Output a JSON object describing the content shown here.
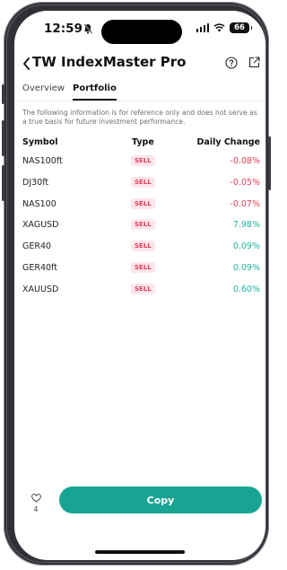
{
  "status_bar": {
    "time": "12:59",
    "battery": "66"
  },
  "header": {
    "title": "TW IndexMaster Pro",
    "icons": [
      "chevron-left-icon",
      "help-icon",
      "share-icon"
    ]
  },
  "tabs": [
    {
      "label": "Overview",
      "active": false
    },
    {
      "label": "Portfolio",
      "active": true
    }
  ],
  "disclaimer": "The following information is for reference only and does not serve as a true basis for future investment performance.",
  "table": {
    "columns": [
      "Symbol",
      "Type",
      "Daily Change"
    ],
    "rows": [
      {
        "symbol": "NAS100ft",
        "type": "SELL",
        "change": "-0.08%"
      },
      {
        "symbol": "DJ30ft",
        "type": "SELL",
        "change": "-0.05%"
      },
      {
        "symbol": "NAS100",
        "type": "SELL",
        "change": "-0.07%"
      },
      {
        "symbol": "XAGUSD",
        "type": "SELL",
        "change": "7.98%"
      },
      {
        "symbol": "GER40",
        "type": "SELL",
        "change": "0.09%"
      },
      {
        "symbol": "GER40ft",
        "type": "SELL",
        "change": "0.09%"
      },
      {
        "symbol": "XAUUSD",
        "type": "SELL",
        "change": "0.60%"
      }
    ]
  },
  "footer": {
    "favorite_count": "4",
    "copy_label": "Copy"
  },
  "colors": {
    "accent": "#17a493",
    "negative": "#e0405a",
    "positive": "#1fb39d",
    "sell_badge_bg": "#fde6ea"
  }
}
